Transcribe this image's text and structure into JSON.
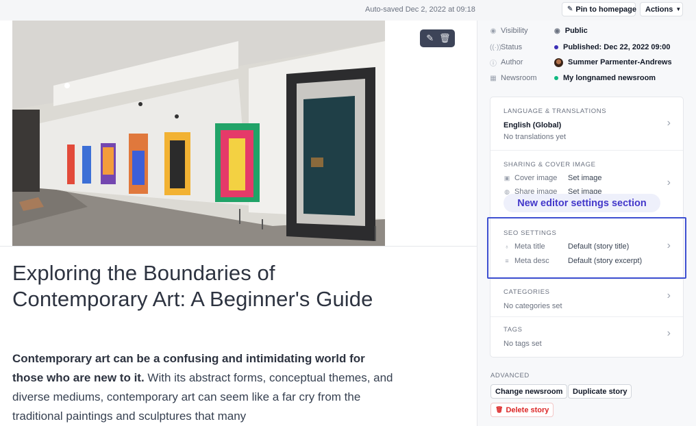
{
  "topbar": {
    "autosave": "Auto-saved Dec 2, 2022 at 09:18",
    "pin_label": "Pin to homepage",
    "actions_label": "Actions"
  },
  "editor": {
    "title": "Exploring the Boundaries of Contemporary Art: A Beginner's Guide",
    "lead_bold": "Contemporary art can be a confusing and intimidating world for those who are new to it.",
    "lead_rest": " With its abstract forms, conceptual themes, and diverse mediums, contemporary art can seem like a far cry from the traditional paintings and sculptures that many",
    "image_tools": [
      "pencil-icon",
      "trash-icon"
    ]
  },
  "meta": [
    {
      "key": "Visibility",
      "icon": "eye-icon",
      "value": "Public",
      "value_icon": "eye-icon"
    },
    {
      "key": "Status",
      "icon": "broadcast-icon",
      "value": "Published: Dec 22, 2022 09:00",
      "dot": "#3b2fb5"
    },
    {
      "key": "Author",
      "icon": "info-icon",
      "value": "Summer Parmenter-Andrews",
      "avatar": true
    },
    {
      "key": "Newsroom",
      "icon": "grid-icon",
      "value": "My longnamed newsroom",
      "dot": "#10b981"
    }
  ],
  "sections": {
    "language": {
      "heading": "LANGUAGE & TRANSLATIONS",
      "value": "English (Global)",
      "sub": "No translations yet"
    },
    "sharing": {
      "heading": "SHARING & COVER IMAGE",
      "rows": [
        {
          "key": "Cover image",
          "value": "Set image"
        },
        {
          "key": "Share image",
          "value": "Set image"
        }
      ]
    },
    "seo": {
      "heading": "SEO SETTINGS",
      "rows": [
        {
          "key": "Meta title",
          "value": "Default (story title)"
        },
        {
          "key": "Meta desc",
          "value": "Default (story excerpt)"
        }
      ]
    },
    "categories": {
      "heading": "CATEGORIES",
      "value": "No categories set"
    },
    "tags": {
      "heading": "TAGS",
      "value": "No tags set"
    }
  },
  "callout": "New editor settings section",
  "advanced": {
    "heading": "ADVANCED",
    "change_newsroom": "Change newsroom",
    "duplicate_story": "Duplicate story",
    "delete_story": "Delete story"
  },
  "colors": {
    "accent": "#3d4fd1",
    "danger": "#dc2626",
    "published_dot": "#3b2fb5",
    "newsroom_dot": "#10b981"
  }
}
